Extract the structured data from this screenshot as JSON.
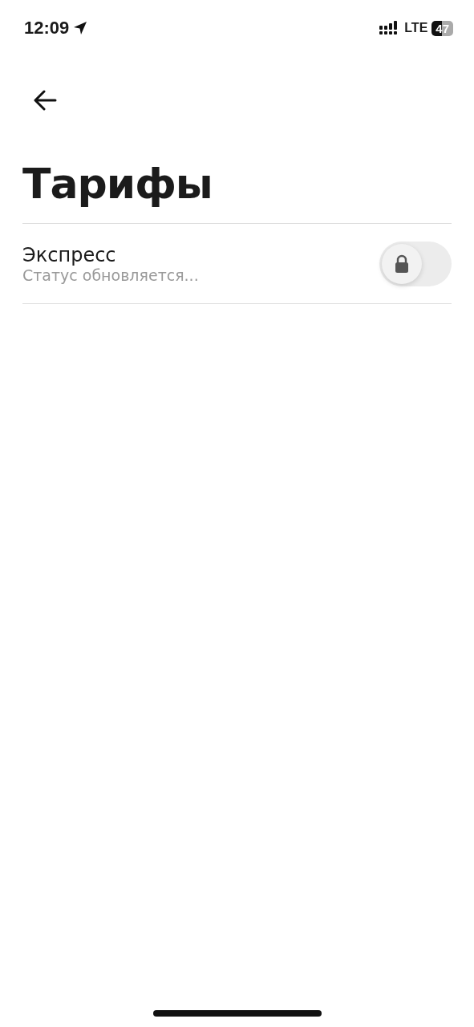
{
  "status_bar": {
    "time": "12:09",
    "network": "LTE",
    "battery": "47"
  },
  "title": "Тарифы",
  "tariffs": [
    {
      "name": "Экспресс",
      "status": "Статус обновляется...",
      "on": false,
      "locked": true
    }
  ]
}
